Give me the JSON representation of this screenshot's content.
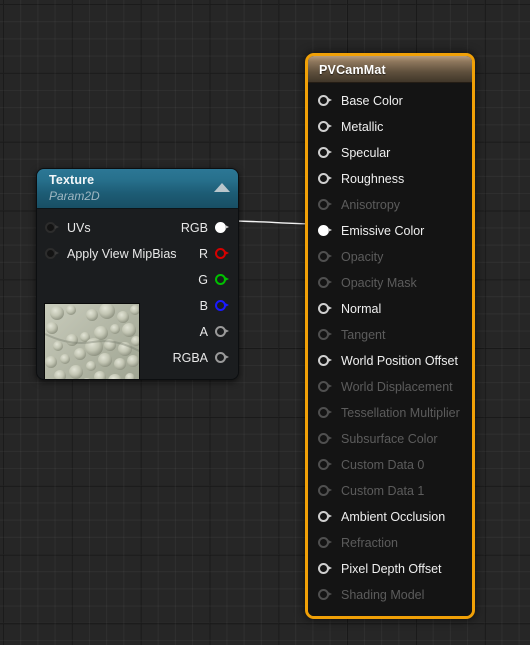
{
  "editor": {
    "name": "material-graph-canvas",
    "background_color": "#262626",
    "grid_minor_color": "#303030",
    "grid_major_color": "#121212"
  },
  "connection": {
    "from_node": "Texture",
    "from_pin": "RGB",
    "to_node": "PVCamMat",
    "to_pin": "Emissive Color",
    "wire_color": "#ffffff"
  },
  "texture_node": {
    "title": "Texture",
    "subtitle": "Param2D",
    "collapse_icon": "triangle-up-icon",
    "title_color": "#27708c",
    "inputs": [
      {
        "label": "UVs",
        "pin": "dark",
        "connected": false
      },
      {
        "label": "Apply View MipBias",
        "pin": "dark",
        "connected": false
      }
    ],
    "outputs": [
      {
        "label": "RGB",
        "pin": "filled",
        "color": "#ffffff",
        "connected": true
      },
      {
        "label": "R",
        "pin": "red",
        "color": "#d60000",
        "connected": false
      },
      {
        "label": "G",
        "pin": "green",
        "color": "#00c000",
        "connected": false
      },
      {
        "label": "B",
        "pin": "blue",
        "color": "#1a1aff",
        "connected": false
      },
      {
        "label": "A",
        "pin": "gray",
        "color": "#9a9a9a",
        "connected": false
      },
      {
        "label": "RGBA",
        "pin": "gray",
        "color": "#9a9a9a",
        "connected": false
      }
    ],
    "thumbnail": {
      "name": "texture-preview-thumbnail",
      "description": "bubble foam texture",
      "base_color": "#b8bbab"
    }
  },
  "material_node": {
    "title": "PVCamMat",
    "selected": true,
    "selection_color": "#f0a007",
    "title_color": "#8d765c",
    "inputs": [
      {
        "label": "Base Color",
        "enabled": true,
        "connected": false
      },
      {
        "label": "Metallic",
        "enabled": true,
        "connected": false
      },
      {
        "label": "Specular",
        "enabled": true,
        "connected": false
      },
      {
        "label": "Roughness",
        "enabled": true,
        "connected": false
      },
      {
        "label": "Anisotropy",
        "enabled": false,
        "connected": false
      },
      {
        "label": "Emissive Color",
        "enabled": true,
        "connected": true
      },
      {
        "label": "Opacity",
        "enabled": false,
        "connected": false
      },
      {
        "label": "Opacity Mask",
        "enabled": false,
        "connected": false
      },
      {
        "label": "Normal",
        "enabled": true,
        "connected": false
      },
      {
        "label": "Tangent",
        "enabled": false,
        "connected": false
      },
      {
        "label": "World Position Offset",
        "enabled": true,
        "connected": false
      },
      {
        "label": "World Displacement",
        "enabled": false,
        "connected": false
      },
      {
        "label": "Tessellation Multiplier",
        "enabled": false,
        "connected": false
      },
      {
        "label": "Subsurface Color",
        "enabled": false,
        "connected": false
      },
      {
        "label": "Custom Data 0",
        "enabled": false,
        "connected": false
      },
      {
        "label": "Custom Data 1",
        "enabled": false,
        "connected": false
      },
      {
        "label": "Ambient Occlusion",
        "enabled": true,
        "connected": false
      },
      {
        "label": "Refraction",
        "enabled": false,
        "connected": false
      },
      {
        "label": "Pixel Depth Offset",
        "enabled": true,
        "connected": false
      },
      {
        "label": "Shading Model",
        "enabled": false,
        "connected": false
      }
    ]
  }
}
